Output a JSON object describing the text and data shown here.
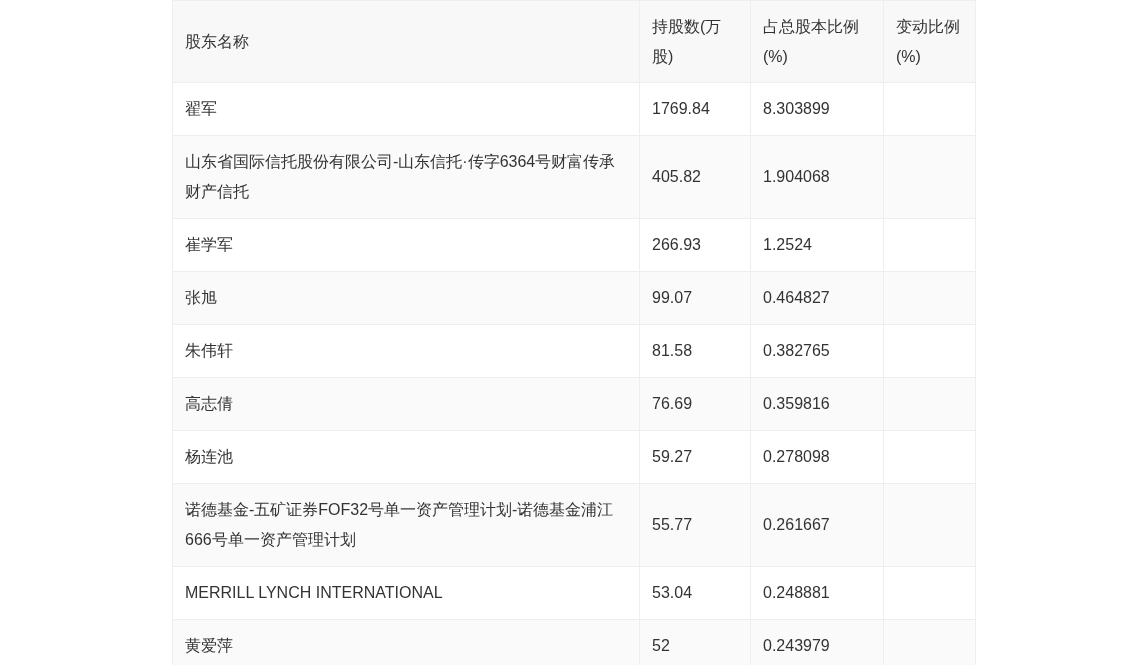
{
  "table": {
    "columns": [
      "股东名称",
      "持股数(万股)",
      "占总股本比例(%)",
      "变动比例(%)"
    ],
    "rows": [
      {
        "name": "翟军",
        "shares": "1769.84",
        "ratio": "8.303899"
      },
      {
        "name": "山东省国际信托股份有限公司-山东信托·传字6364号财富传承财产信托",
        "shares": "405.82",
        "ratio": "1.904068"
      },
      {
        "name": "崔学军",
        "shares": "266.93",
        "ratio": "1.2524"
      },
      {
        "name": "张旭",
        "shares": "99.07",
        "ratio": "0.464827"
      },
      {
        "name": "朱伟轩",
        "shares": "81.58",
        "ratio": "0.382765"
      },
      {
        "name": "高志倩",
        "shares": "76.69",
        "ratio": "0.359816"
      },
      {
        "name": "杨连池",
        "shares": "59.27",
        "ratio": "0.278098"
      },
      {
        "name": "诺德基金-五矿证券FOF32号单一资产管理计划-诺德基金浦江666号单一资产管理计划",
        "shares": "55.77",
        "ratio": "0.261667"
      },
      {
        "name": "MERRILL LYNCH INTERNATIONAL",
        "shares": "53.04",
        "ratio": "0.248881"
      },
      {
        "name": "黄爱萍",
        "shares": "52",
        "ratio": "0.243979"
      }
    ]
  }
}
